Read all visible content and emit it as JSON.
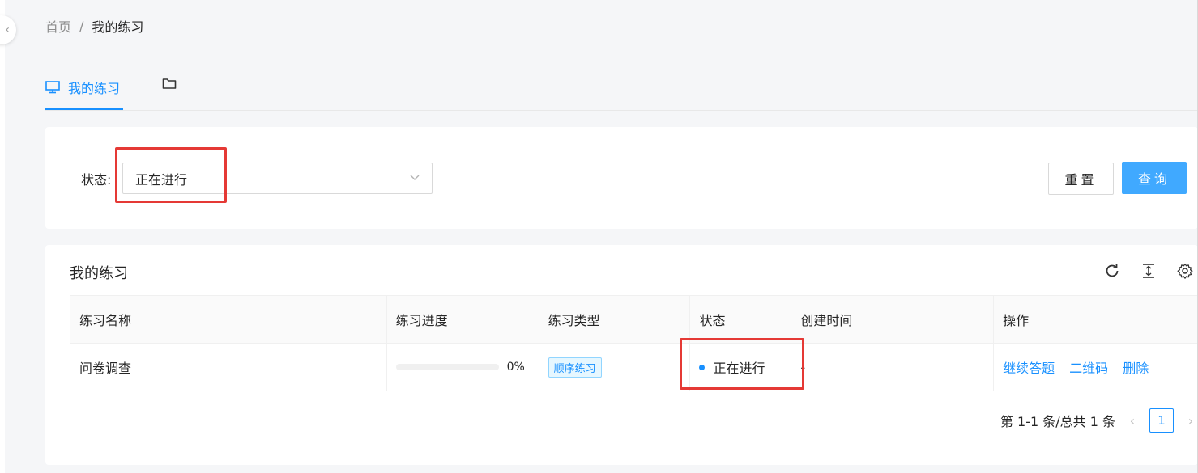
{
  "breadcrumb": {
    "home": "首页",
    "separator": "/",
    "current": "我的练习"
  },
  "tabs": [
    {
      "label": "我的练习",
      "icon": "monitor-icon"
    },
    {
      "label": "",
      "icon": "folder-icon"
    }
  ],
  "filter": {
    "status_label": "状态:",
    "status_value": "正在进行",
    "reset_label": "重置",
    "query_label": "查询"
  },
  "table": {
    "title": "我的练习",
    "columns": [
      "练习名称",
      "练习进度",
      "练习类型",
      "状态",
      "创建时间",
      "操作"
    ],
    "rows": [
      {
        "name": "问卷调查",
        "progress": 0,
        "progress_text": "0%",
        "type": "顺序练习",
        "status": "正在进行",
        "created": "-",
        "actions": [
          "继续答题",
          "二维码",
          "删除"
        ]
      }
    ]
  },
  "pagination": {
    "summary": "第 1-1 条/总共 1 条",
    "current_page": "1",
    "prev": "‹",
    "next": "›"
  },
  "colors": {
    "primary": "#1890ff",
    "highlight": "#e53935"
  }
}
